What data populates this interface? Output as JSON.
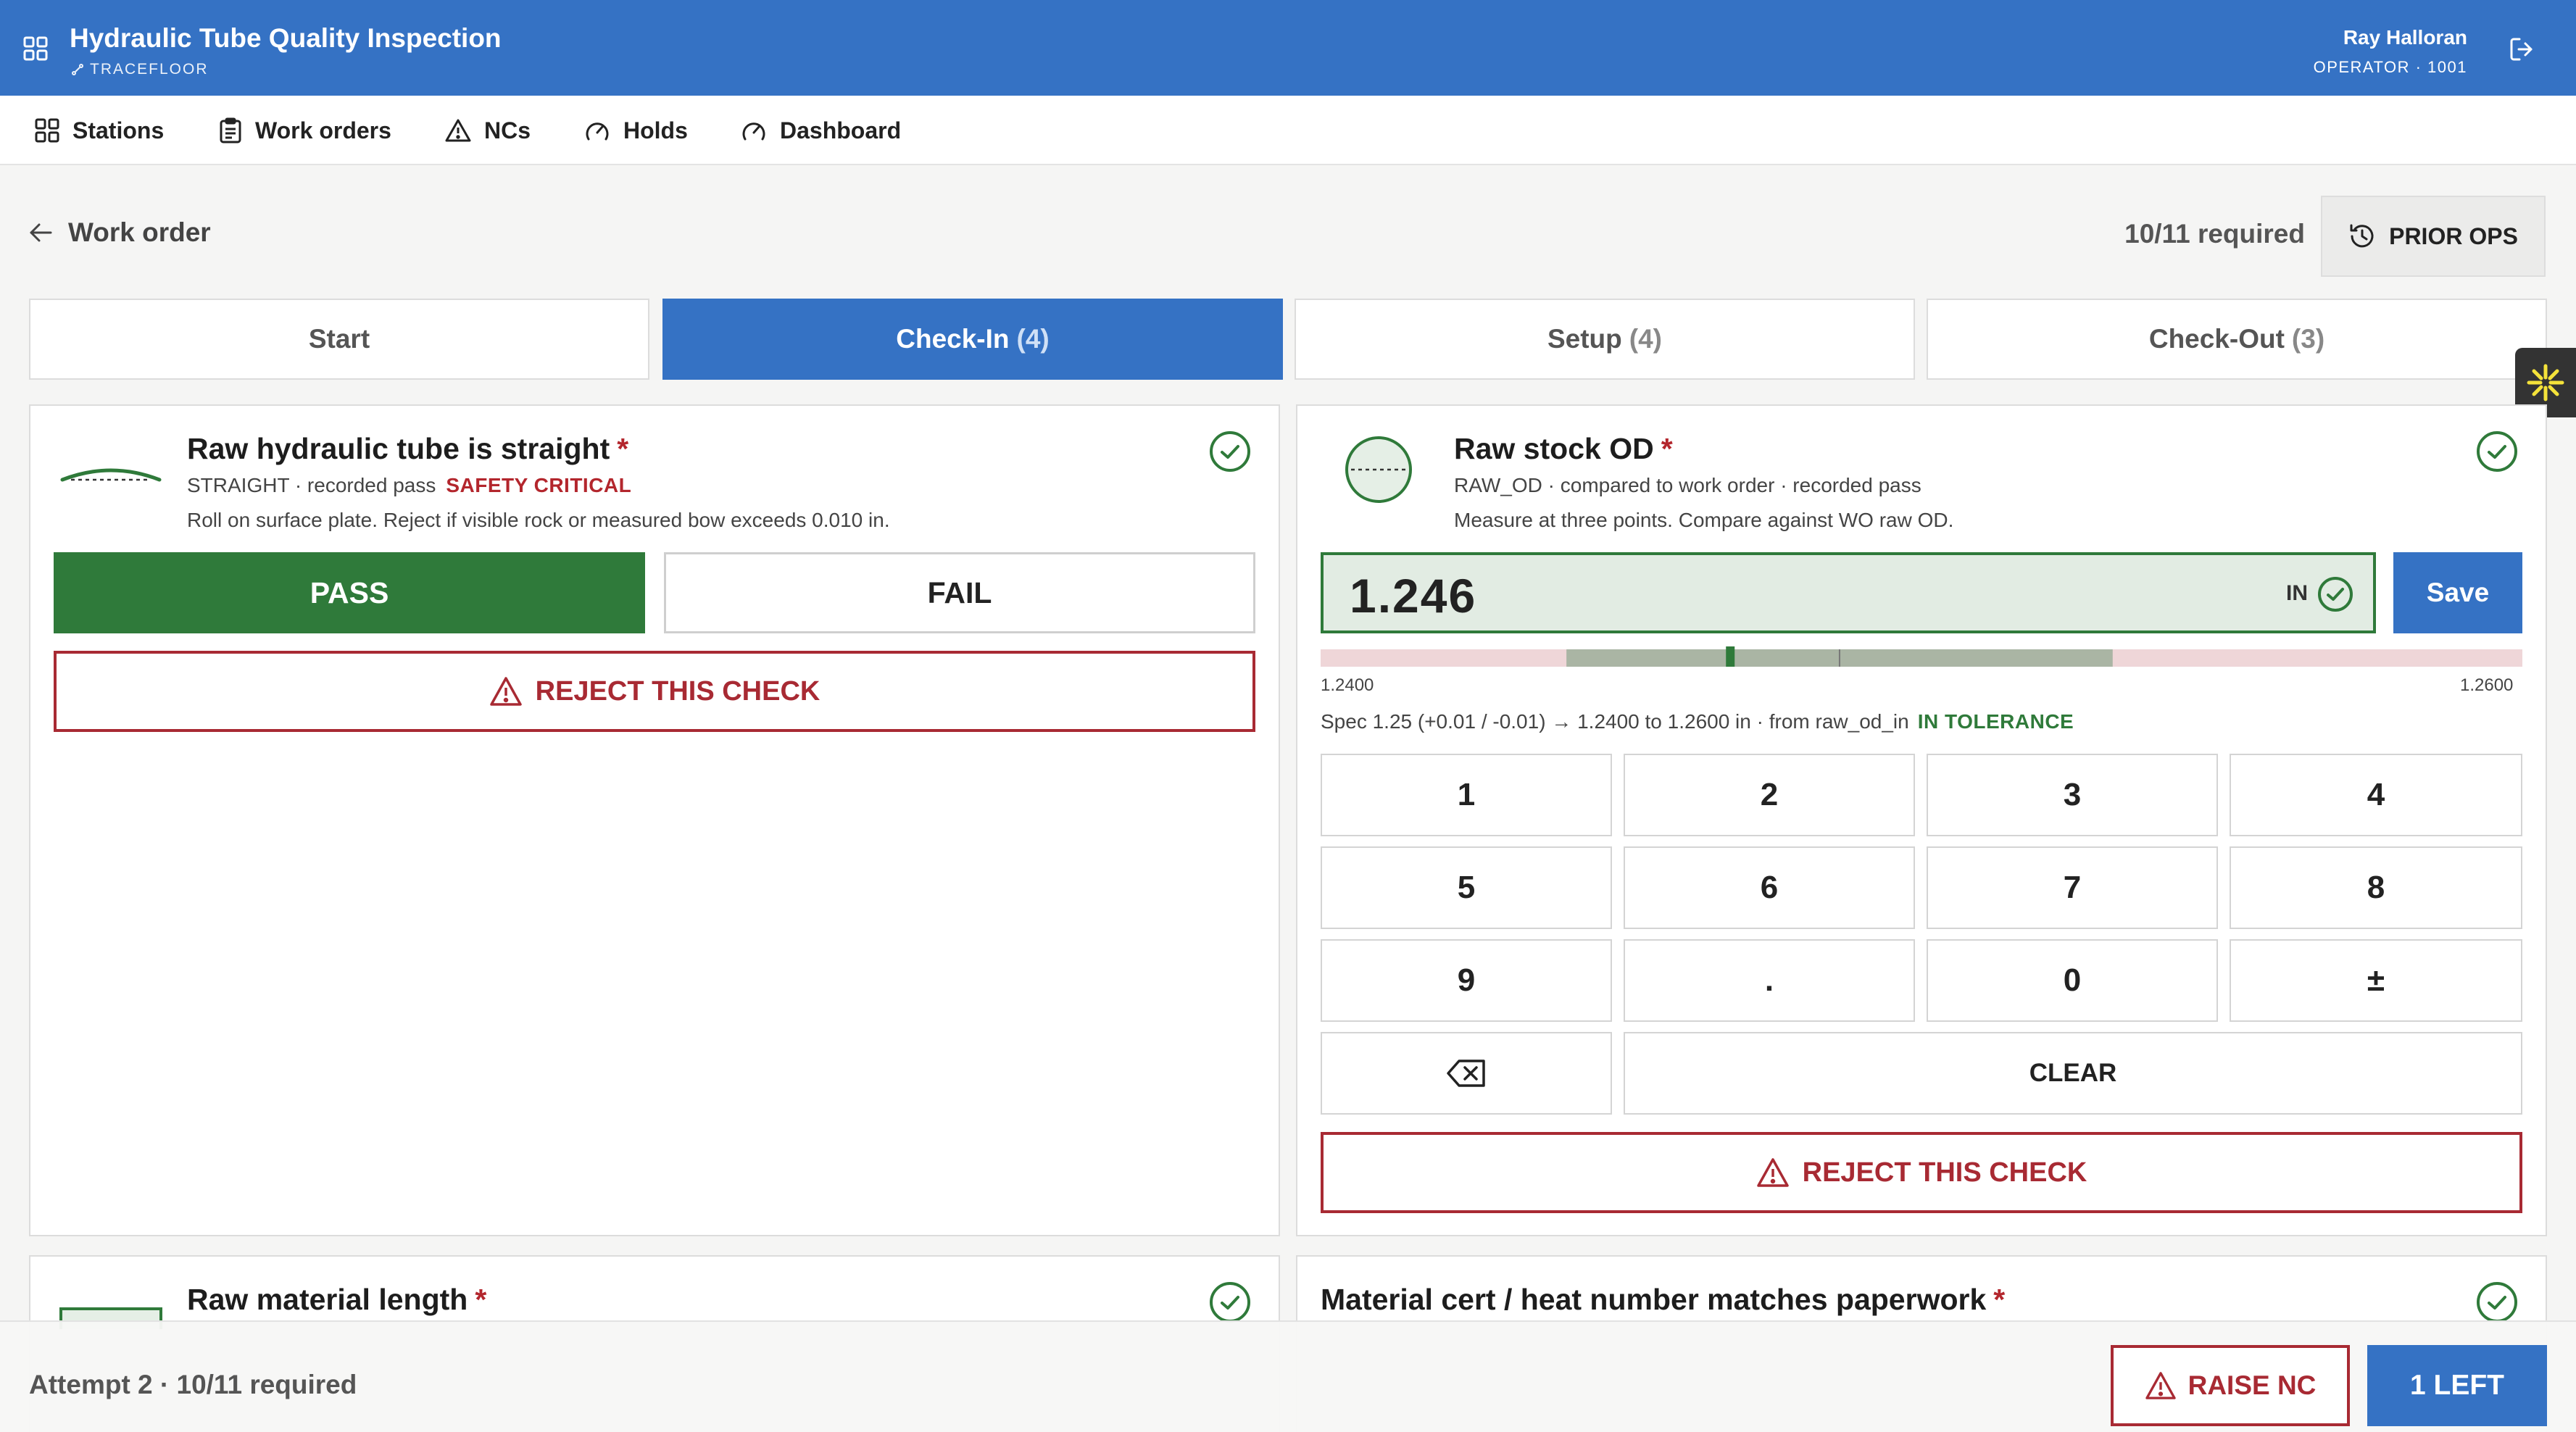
{
  "header": {
    "app_title": "Hydraulic Tube Quality Inspection",
    "brand": "TRACEFLOOR",
    "user_name": "Ray Halloran",
    "user_role": "OPERATOR · 1001"
  },
  "nav": {
    "items": [
      {
        "label": "Stations",
        "icon": "grid-icon"
      },
      {
        "label": "Work orders",
        "icon": "clipboard-icon"
      },
      {
        "label": "NCs",
        "icon": "warning-icon"
      },
      {
        "label": "Holds",
        "icon": "gauge-icon"
      },
      {
        "label": "Dashboard",
        "icon": "gauge-icon"
      }
    ]
  },
  "page": {
    "back_label": "Work order",
    "required": "10/11 required",
    "prior_ops_label": "PRIOR OPS"
  },
  "tabs": [
    {
      "label": "Start",
      "count": "",
      "active": false
    },
    {
      "label": "Check-In",
      "count": "(4)",
      "active": true
    },
    {
      "label": "Setup",
      "count": "(4)",
      "active": false
    },
    {
      "label": "Check-Out",
      "count": "(3)",
      "active": false
    }
  ],
  "check_straight": {
    "title": "Raw hydraulic tube is straight",
    "required_mark": "*",
    "meta": "STRAIGHT · recorded pass",
    "critical": "SAFETY CRITICAL",
    "description": "Roll on surface plate. Reject if visible rock or measured bow exceeds 0.010 in.",
    "pass_label": "PASS",
    "fail_label": "FAIL",
    "reject_label": "REJECT THIS CHECK",
    "result": "pass"
  },
  "check_od": {
    "title": "Raw stock OD",
    "required_mark": "*",
    "meta": "RAW_OD · compared to work order · recorded pass",
    "description": "Measure at three points. Compare against WO raw OD.",
    "value": "1.246",
    "unit": "IN",
    "save_label": "Save",
    "range_low": "1.2400",
    "range_high": "1.2600",
    "measured": 1.246,
    "nominal": 1.25,
    "spec_text": "Spec 1.25 (+0.01 / -0.01) → 1.2400 to 1.2600 in · from raw_od_in",
    "status": "IN TOLERANCE",
    "keys": [
      "1",
      "2",
      "3",
      "4",
      "5",
      "6",
      "7",
      "8",
      "9",
      ".",
      "0",
      "±"
    ],
    "clear_label": "CLEAR",
    "reject_label": "REJECT THIS CHECK"
  },
  "check_length": {
    "title": "Raw material length",
    "required_mark": "*"
  },
  "check_cert": {
    "title": "Material cert / heat number matches paperwork",
    "required_mark": "*"
  },
  "footer": {
    "attempt": "Attempt 2 · 10/11 required",
    "raise_nc_label": "RAISE NC",
    "left_label": "1 LEFT"
  },
  "colors": {
    "brand_blue": "#3572c4",
    "pass_green": "#2f7a3a",
    "reject_red": "#a82a33"
  }
}
